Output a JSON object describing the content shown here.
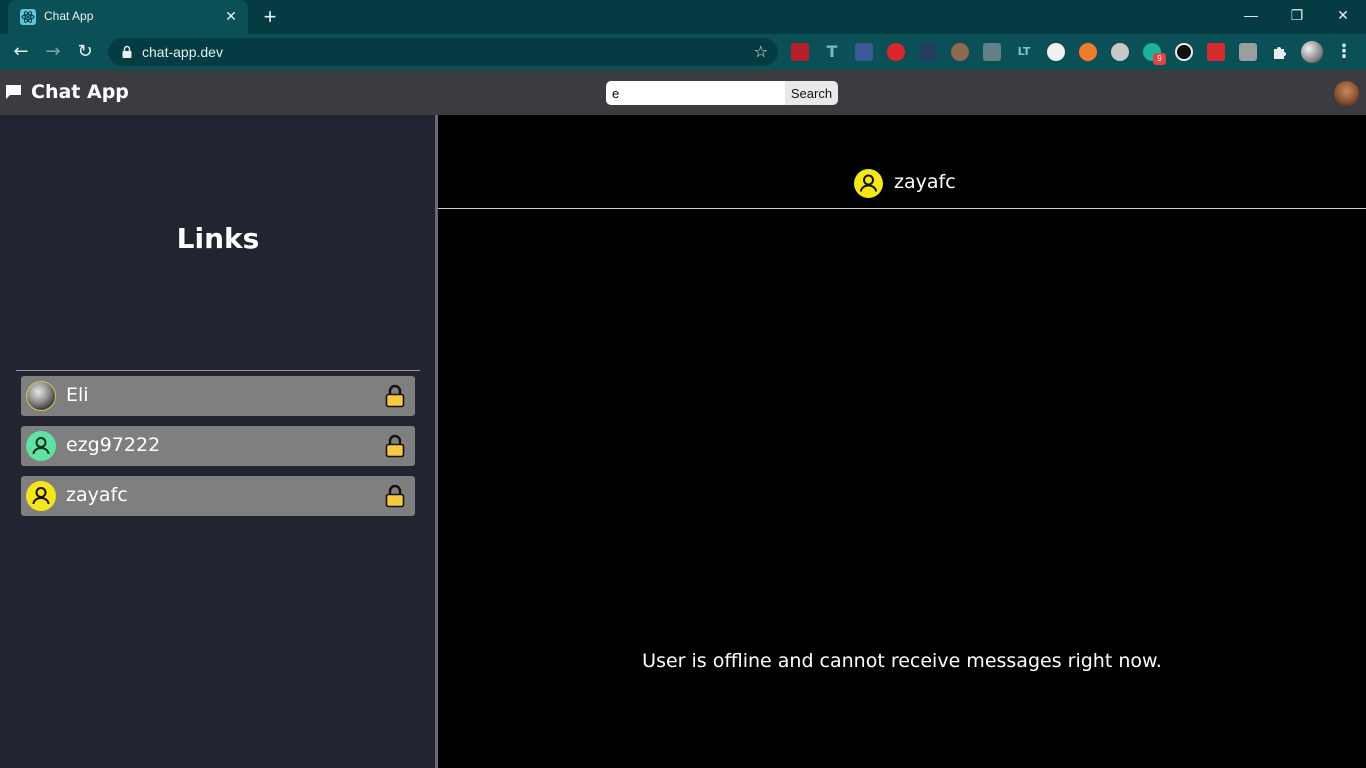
{
  "browser": {
    "tab_title": "Chat App",
    "url": "chat-app.dev",
    "extension_badge": "9",
    "colors": {
      "frame": "#053b43",
      "toolbar": "#0b5057"
    }
  },
  "header": {
    "title": "Chat App",
    "search": {
      "value": "e",
      "button_label": "Search"
    }
  },
  "sidebar": {
    "title": "Links",
    "items": [
      {
        "name": "Eli",
        "avatar": "photo-avatar",
        "locked": true
      },
      {
        "name": "ezg97222",
        "avatar": "default-user-icon",
        "avatar_color": "#5fe3a5",
        "locked": true
      },
      {
        "name": "zayafc",
        "avatar": "default-user-icon",
        "avatar_color": "#f5e61a",
        "locked": true
      }
    ]
  },
  "chat": {
    "contact_name": "zayafc",
    "contact_avatar_color": "#f5e61a",
    "status_message": "User is offline and cannot receive messages right now."
  }
}
